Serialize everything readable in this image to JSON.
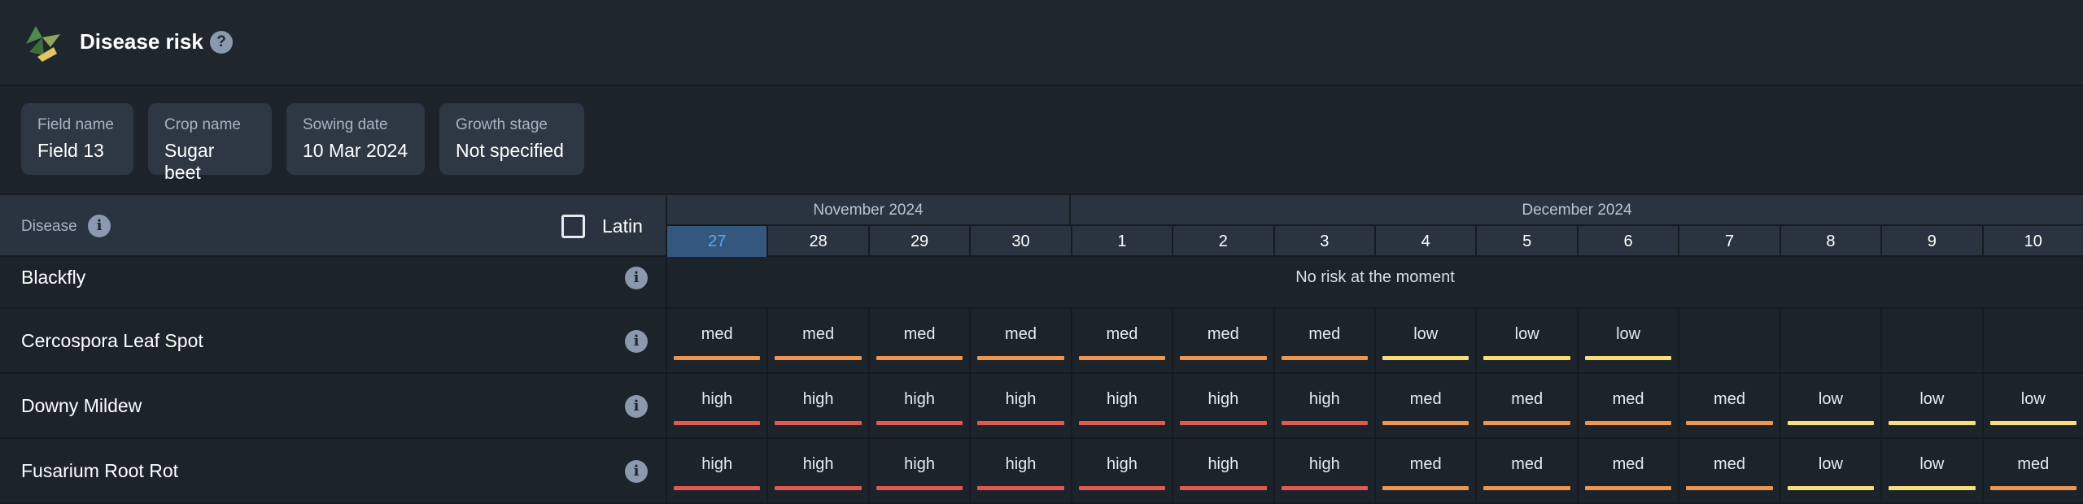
{
  "header": {
    "title": "Disease risk",
    "help_icon": "?",
    "logo_icon": "leaf-logo-icon"
  },
  "field_info": [
    {
      "label": "Field name",
      "value": "Field 13"
    },
    {
      "label": "Crop name",
      "value": "Sugar beet"
    },
    {
      "label": "Sowing date",
      "value": "10 Mar 2024"
    },
    {
      "label": "Growth stage",
      "value": "Not specified"
    }
  ],
  "table": {
    "disease_header": "Disease",
    "info_icon": "i",
    "latin_label": "Latin",
    "latin_checked": false,
    "months": [
      "November 2024",
      "December 2024"
    ],
    "days": [
      "27",
      "28",
      "29",
      "30",
      "1",
      "2",
      "3",
      "4",
      "5",
      "6",
      "7",
      "8",
      "9",
      "10"
    ],
    "today_index": 0,
    "rows": [
      {
        "name": "Blackfly",
        "no_risk_text": "No risk at the moment",
        "risks": []
      },
      {
        "name": "Cercospora Leaf Spot",
        "risks": [
          "med",
          "med",
          "med",
          "med",
          "med",
          "med",
          "med",
          "low",
          "low",
          "low",
          "",
          "",
          "",
          ""
        ]
      },
      {
        "name": "Downy Mildew",
        "risks": [
          "high",
          "high",
          "high",
          "high",
          "high",
          "high",
          "high",
          "med",
          "med",
          "med",
          "med",
          "low",
          "low",
          "low"
        ]
      },
      {
        "name": "Fusarium Root Rot",
        "risks": [
          "high",
          "high",
          "high",
          "high",
          "high",
          "high",
          "high",
          "med",
          "med",
          "med",
          "med",
          "low",
          "low",
          "med"
        ]
      }
    ]
  },
  "colors": {
    "high": "#e05a52",
    "med": "#ee9550",
    "low": "#f6dd7e",
    "today_bg": "#34577e",
    "accent": "#5fa6ee"
  }
}
